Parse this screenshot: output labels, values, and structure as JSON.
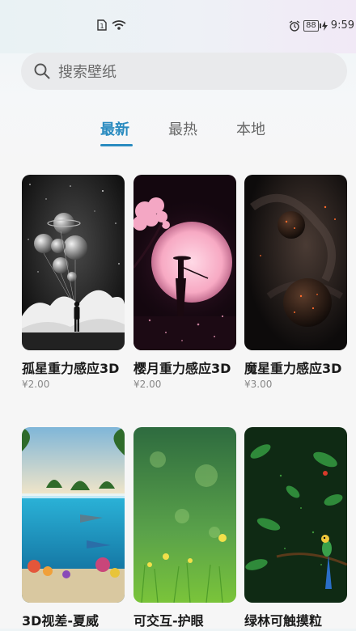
{
  "status_bar": {
    "time": "9:59",
    "battery": "88"
  },
  "search": {
    "placeholder": "搜索壁纸"
  },
  "tabs": [
    {
      "label": "最新",
      "active": true
    },
    {
      "label": "最热",
      "active": false
    },
    {
      "label": "本地",
      "active": false
    }
  ],
  "wallpapers": [
    {
      "title": "孤星重力感应3D",
      "price": "¥2.00"
    },
    {
      "title": "樱月重力感应3D",
      "price": "¥2.00"
    },
    {
      "title": "魔星重力感应3D",
      "price": "¥3.00"
    },
    {
      "title": "3D视差-夏威",
      "price": ""
    },
    {
      "title": "可交互-护眼",
      "price": ""
    },
    {
      "title": "绿林可触摸粒",
      "price": ""
    }
  ],
  "colors": {
    "accent": "#2a8bc0"
  }
}
